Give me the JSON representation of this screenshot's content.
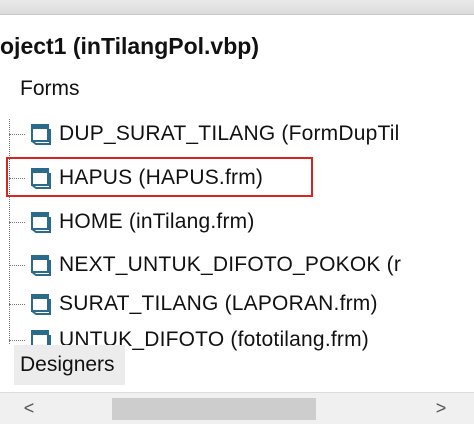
{
  "project": {
    "label": "oject1 (inTilangPol.vbp)"
  },
  "folders": {
    "forms": "Forms",
    "designers": "Designers"
  },
  "forms": [
    {
      "label": "DUP_SURAT_TILANG (FormDupTil"
    },
    {
      "label": "HAPUS (HAPUS.frm)",
      "selected": true
    },
    {
      "label": "HOME (inTilang.frm)"
    },
    {
      "label": "NEXT_UNTUK_DIFOTO_POKOK (r"
    },
    {
      "label": "SURAT_TILANG (LAPORAN.frm)"
    },
    {
      "label": "UNTUK_DIFOTO (fototilang.frm)"
    }
  ],
  "scrollbar": {
    "left_arrow": "<",
    "right_arrow": ">",
    "thumb_position": 0.25
  },
  "colors": {
    "highlight_border": "#d9241f",
    "form_icon": "#2a6a8a"
  }
}
